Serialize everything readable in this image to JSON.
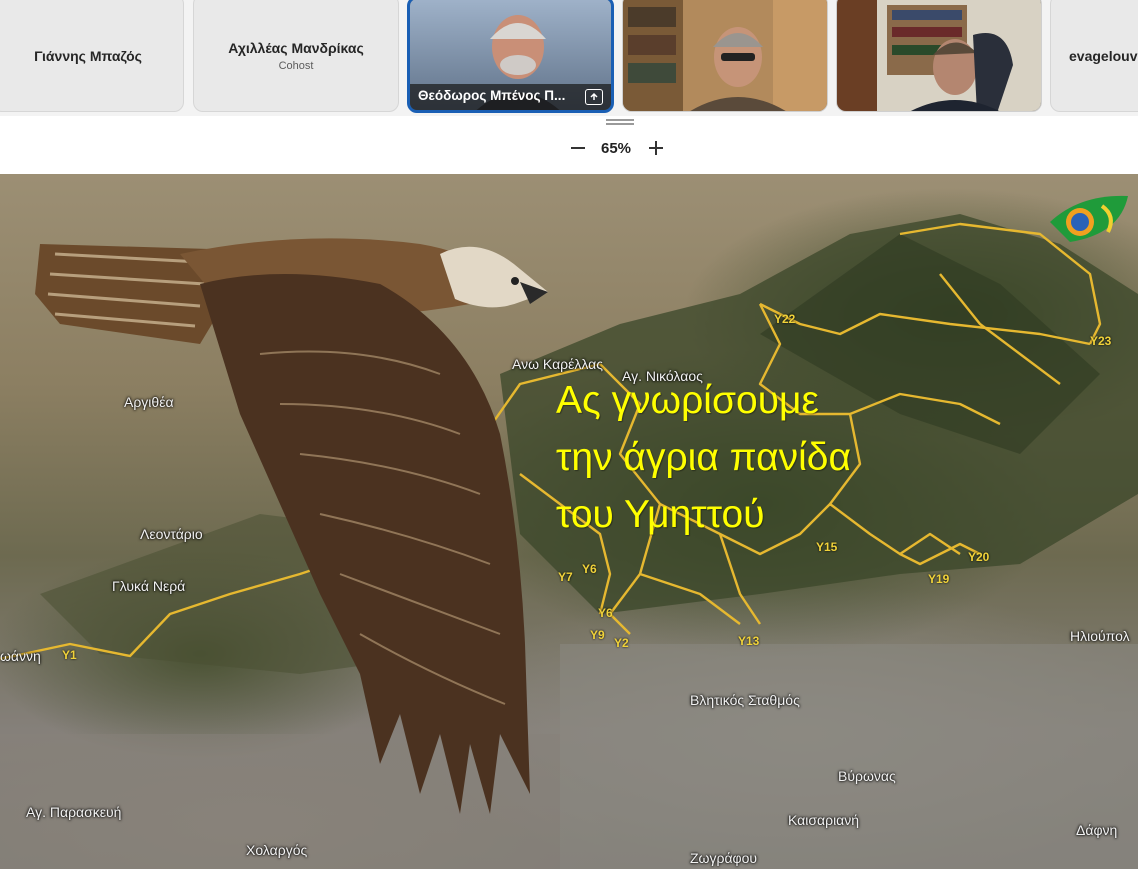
{
  "participants": [
    {
      "name": "Γιάννης Μπαζός",
      "role": "",
      "video": false,
      "active": false
    },
    {
      "name": "Αχιλλέας Μανδρίκας",
      "role": "Cohost",
      "video": false,
      "active": false
    },
    {
      "name": "Θεόδωρος Μπένος Π...",
      "role": "",
      "video": true,
      "active": true,
      "icon": "screen-share-icon"
    },
    {
      "name": "",
      "role": "",
      "video": true,
      "active": false
    },
    {
      "name": "",
      "role": "",
      "video": true,
      "active": false
    },
    {
      "name": "evagelouv",
      "role": "",
      "video": false,
      "active": false
    }
  ],
  "zoom": {
    "level": "65%",
    "minus_icon": "minus-icon",
    "plus_icon": "plus-icon"
  },
  "slide": {
    "headline": [
      "Ας γνωρίσουμε",
      "την άγρια πανίδα",
      "του Υμηττού"
    ],
    "headline_color": "#ffff00",
    "places": {
      "ano_karellas": "Ανω Καρέλλας",
      "ag_nikolaos": "Αγ. Νικόλαος",
      "argithea": "Αργιθέα",
      "leontario": "Λεοντάριο",
      "glyka_nera": "Γλυκά Νερά",
      "ioanni": "ωάννη",
      "vlitikos": "Βλητικός Σταθμός",
      "vyronas": "Βύρωνας",
      "ag_paraskevi": "Αγ. Παρασκευή",
      "kaisariani": "Καισαριανή",
      "xolargos": "Χολαργός",
      "zografou": "Ζωγράφου",
      "dafni": "Δάφνη",
      "ilioupoli": "Ηλιούπολ"
    },
    "routes": {
      "y1": "Y1",
      "y2": "Y2",
      "y6a": "Y6",
      "y6b": "Y6",
      "y7": "Y7",
      "y9": "Y9",
      "y13": "Y13",
      "y15": "Y15",
      "y19": "Y19",
      "y20": "Y20",
      "y22": "Y22",
      "y23": "Y23"
    },
    "trail_color": "#e6b830"
  }
}
